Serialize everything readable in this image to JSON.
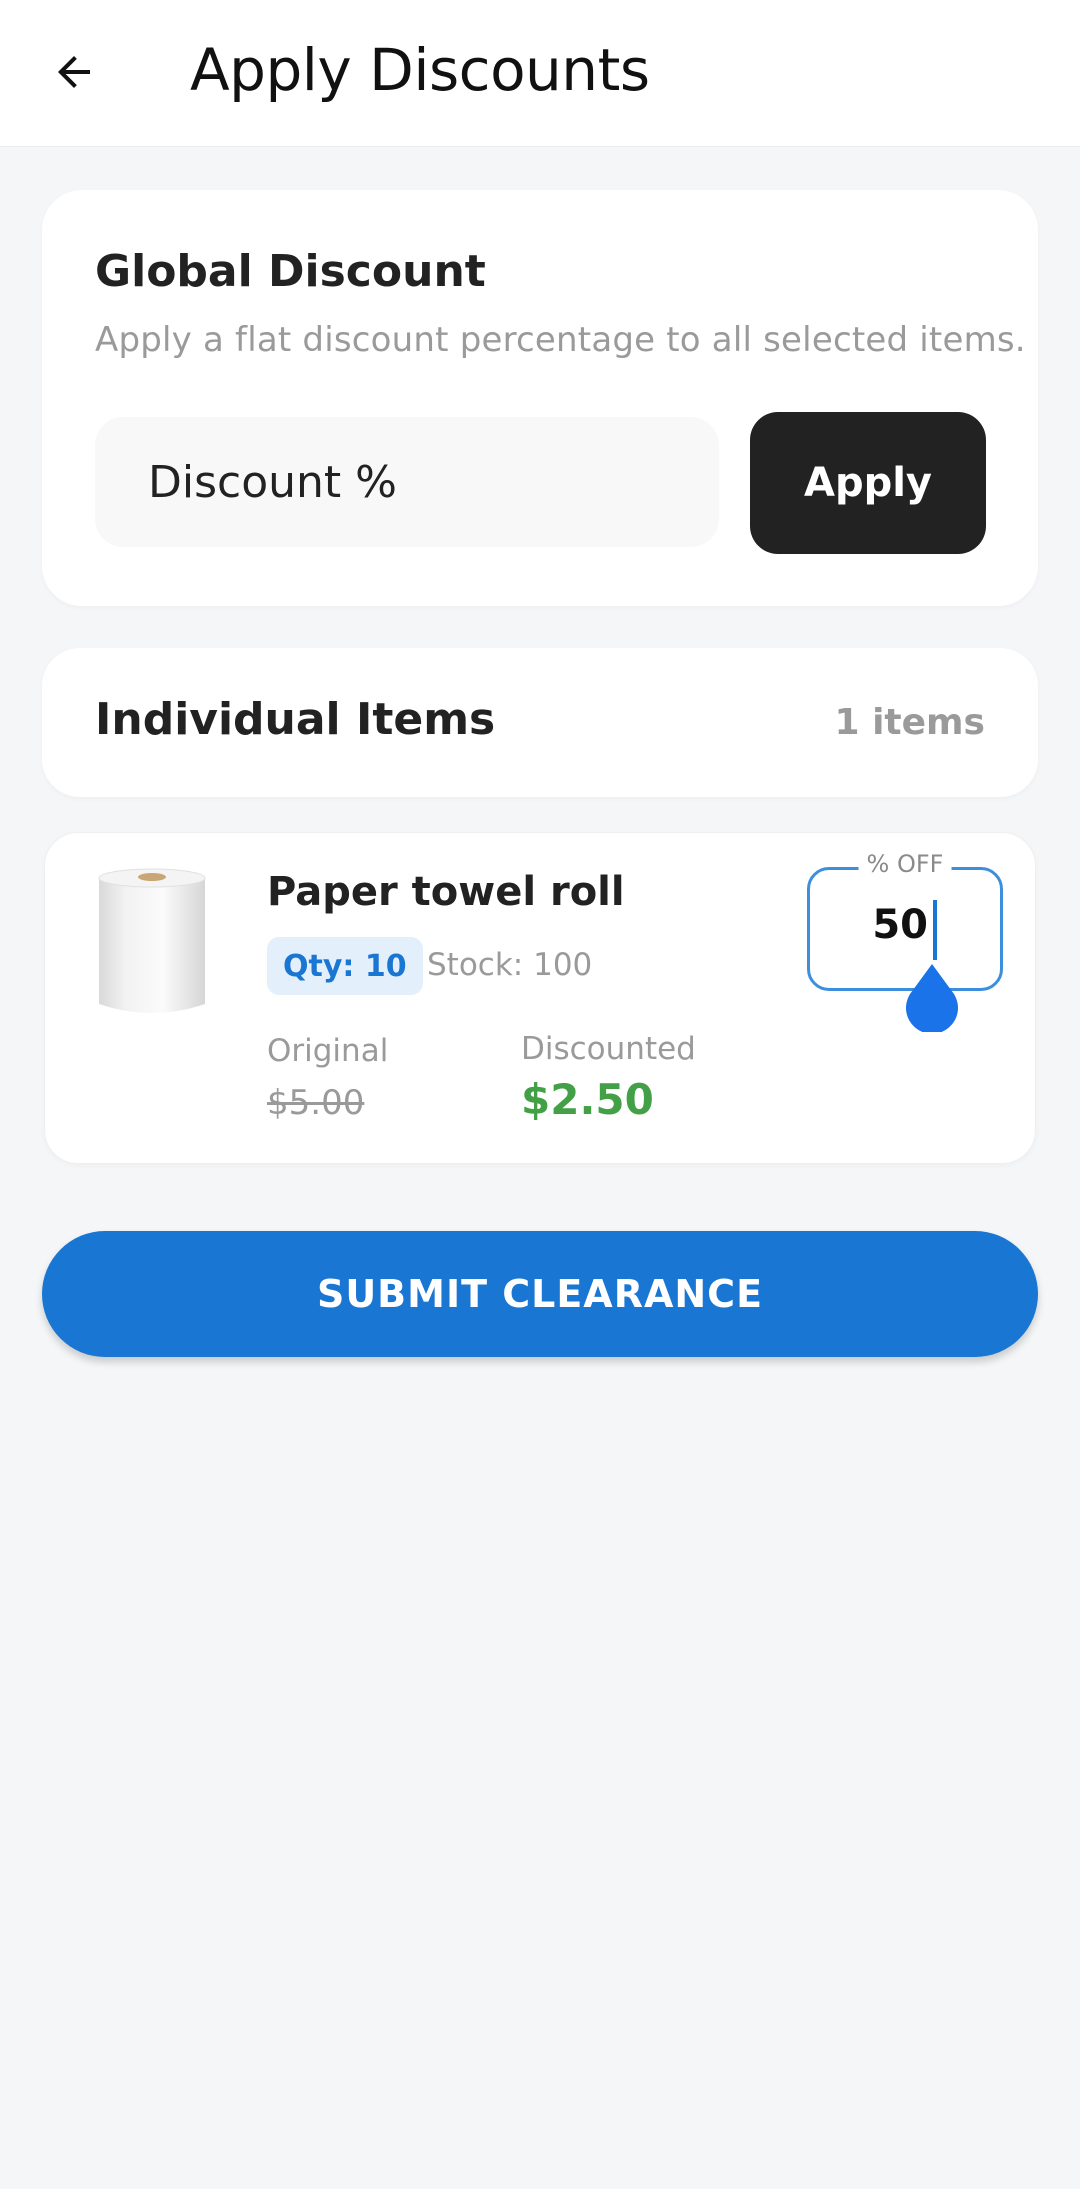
{
  "appbar": {
    "title": "Apply Discounts",
    "back_icon": "arrow-left-icon"
  },
  "global_discount": {
    "title": "Global Discount",
    "subtitle": "Apply a flat discount percentage to all selected items.",
    "input_placeholder": "Discount %",
    "input_value": "",
    "apply_label": "Apply"
  },
  "individual_items": {
    "title": "Individual Items",
    "count_label": "1 items"
  },
  "items": [
    {
      "name": "Paper towel roll",
      "qty_label": "Qty: 10",
      "stock_label": "Stock: 100",
      "original_label": "Original",
      "original_price": "$5.00",
      "discounted_label": "Discounted",
      "discounted_price": "$2.50",
      "percent_label": "% OFF",
      "percent_value": "50",
      "image_icon": "paper-towel-roll-image"
    }
  ],
  "submit_label": "SUBMIT CLEARANCE",
  "colors": {
    "primary": "#1976d2",
    "success": "#43a047",
    "dark_button": "#222222",
    "background": "#f5f6f8"
  }
}
